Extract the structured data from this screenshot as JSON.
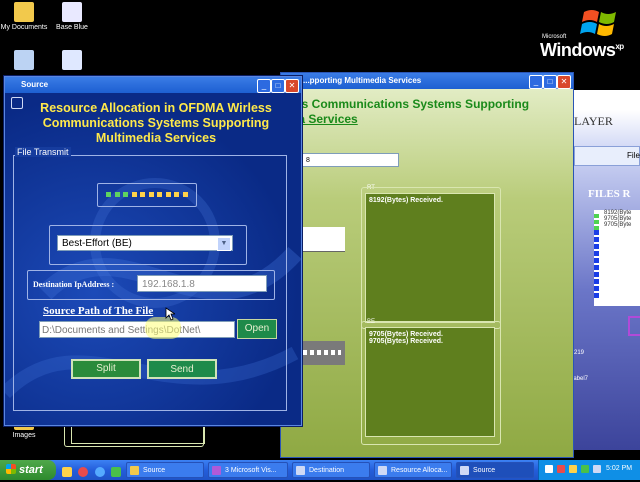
{
  "desktop": {
    "icons": [
      {
        "label": "My Documents",
        "color": "#f2c94c"
      },
      {
        "label": "Base Blue",
        "color": "#e9e9ff"
      },
      {
        "label": "Images",
        "color": "#f2c94c"
      }
    ]
  },
  "os_logo": {
    "microsoft": "Microsoft",
    "windows": "Windows",
    "xp": "xp"
  },
  "destination_window": {
    "title": "...pporting Multimedia Services",
    "heading_line1": "...ss Communications Systems Supporting",
    "heading_line2": "...ia Services",
    "field_value": "8",
    "rt_caption": "RT",
    "be_caption": "BE",
    "rt_log": [
      "8192(Bytes) Received."
    ],
    "be_log": [
      "9705(Bytes) Received.",
      "9705(Bytes) Received."
    ]
  },
  "third_window": {
    "layer_text": "LAYER",
    "button": "File",
    "files_header": "FILES R",
    "log": [
      "8192(Byte",
      "9705(Byte",
      "9705(Byte"
    ],
    "bottom_text1": "219",
    "bottom_text2": "label7"
  },
  "source_window": {
    "title": "Source",
    "heading": "Resource Allocation in OFDMA Wirless Communications Systems Supporting Multimedia Services",
    "fieldset_legend": "File Transmit",
    "indicator_colors": [
      "#5fd35f",
      "#5fd35f",
      "#5fd35f",
      "#ffd24a",
      "#ffd24a",
      "#ffd24a",
      "#ffd24a",
      "#ffd24a",
      "#ffd24a",
      "#ffd24a"
    ],
    "service_selected": "Best-Effort (BE)",
    "ip_label": "Destination IpAddress :",
    "ip_value": "192.168.1.8",
    "path_label": "Source Path of The File",
    "path_value": "D:\\Documents and Settings\\DotNet\\",
    "open_label": "Open",
    "split_label": "Split",
    "send_label": "Send"
  },
  "taskbar": {
    "start_label": "start",
    "items": [
      {
        "label": "Source",
        "active": false
      },
      {
        "label": "3 Microsoft Vis...",
        "active": false
      },
      {
        "label": "Destination",
        "active": false
      },
      {
        "label": "Resource Alloca...",
        "active": false
      },
      {
        "label": "Source",
        "active": true
      }
    ],
    "clock": "5:02 PM"
  }
}
